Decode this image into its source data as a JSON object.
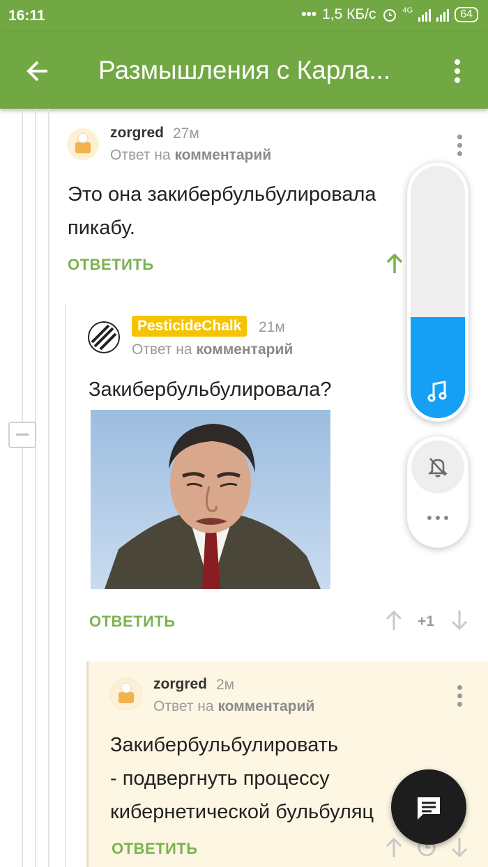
{
  "status_bar": {
    "time": "16:11",
    "speed": "1,5 КБ/с",
    "network": "4G",
    "battery": "64"
  },
  "app_bar": {
    "title": "Размышления с Карла..."
  },
  "comments": [
    {
      "username": "zorgred",
      "time_ago": "27м",
      "reply_prefix": "Ответ на",
      "reply_target": "комментарий",
      "text_lines": [
        "Это она закибербульбулировала",
        "пикабу."
      ],
      "answer_label": "ОТВЕТИТЬ"
    },
    {
      "username": "PesticideChalk",
      "time_ago": "21м",
      "reply_prefix": "Ответ на",
      "reply_target": "комментарий",
      "text_lines": [
        "Закибербульбулировала?"
      ],
      "answer_label": "ОТВЕТИТЬ",
      "score": "+1"
    },
    {
      "username": "zorgred",
      "time_ago": "2м",
      "reply_prefix": "Ответ на",
      "reply_target": "комментарий",
      "text_lines": [
        "Закибербульбулировать",
        "- подвергнуть процессу",
        "кибернетической бульбуляц"
      ],
      "answer_label": "ОТВЕТИТЬ"
    }
  ],
  "volume_level_percent": 40,
  "colors": {
    "accent_green": "#72a843",
    "link_green": "#7bb24f",
    "badge_yellow": "#f5c400",
    "highlight_bg": "#fdf6e3",
    "volume_blue": "#15a0f5"
  },
  "icons": [
    "back-arrow-icon",
    "more-vert-icon",
    "music-note-icon",
    "bell-off-icon",
    "more-horiz-icon",
    "comment-icon",
    "upvote-icon",
    "downvote-icon"
  ]
}
